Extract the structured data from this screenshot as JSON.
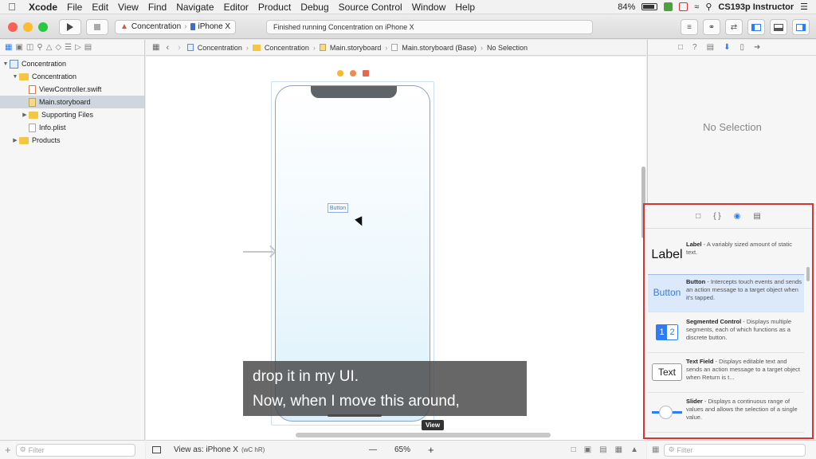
{
  "menubar": {
    "apple": "",
    "app": "Xcode",
    "items": [
      "File",
      "Edit",
      "View",
      "Find",
      "Navigate",
      "Editor",
      "Product",
      "Debug",
      "Source Control",
      "Window",
      "Help"
    ],
    "battery": "84%",
    "user": "CS193p Instructor"
  },
  "toolbar": {
    "scheme": "Concentration",
    "device": "iPhone X",
    "activity": "Finished running Concentration on iPhone X"
  },
  "navigator": {
    "tree": [
      {
        "label": "Concentration",
        "kind": "project",
        "disclosure": "▼",
        "indent": 0
      },
      {
        "label": "Concentration",
        "kind": "folder",
        "disclosure": "▼",
        "indent": 1
      },
      {
        "label": "ViewController.swift",
        "kind": "swift",
        "disclosure": "",
        "indent": 2
      },
      {
        "label": "Main.storyboard",
        "kind": "storyboard",
        "disclosure": "",
        "indent": 2,
        "selected": true
      },
      {
        "label": "Supporting Files",
        "kind": "folder",
        "disclosure": "▶",
        "indent": 2
      },
      {
        "label": "Info.plist",
        "kind": "plist",
        "disclosure": "",
        "indent": 2
      },
      {
        "label": "Products",
        "kind": "folder",
        "disclosure": "▶",
        "indent": 1
      }
    ],
    "filter_placeholder": "Filter"
  },
  "jumpbar": {
    "crumbs": [
      "Concentration",
      "Concentration",
      "Main.storyboard",
      "Main.storyboard (Base)",
      "No Selection"
    ]
  },
  "canvas": {
    "button_label": "Button",
    "view_tag": "View"
  },
  "caption": {
    "line1": "drop it in my UI.",
    "line2": "Now, when I move this around,"
  },
  "editor_bar": {
    "view_as": "View as: iPhone X",
    "view_as_suffix": "(wC hR)",
    "zoom_out": "—",
    "zoom": "65%",
    "zoom_in": "+"
  },
  "inspector": {
    "no_selection": "No Selection"
  },
  "library": {
    "items": [
      {
        "thumb": "Label",
        "title": "Label",
        "desc": " - A variably sized amount of static text."
      },
      {
        "thumb": "Button",
        "title": "Button",
        "desc": " - Intercepts touch events and sends an action message to a target object when it's tapped."
      },
      {
        "thumb": "1|2",
        "title": "Segmented Control",
        "desc": " - Displays multiple segments, each of which functions as a discrete button."
      },
      {
        "thumb": "Text",
        "title": "Text Field",
        "desc": " - Displays editable text and sends an action message to a target object when Return is t..."
      },
      {
        "thumb": "",
        "title": "Slider",
        "desc": " - Displays a continuous range of values and allows the selection of a single value."
      }
    ],
    "filter_placeholder": "Filter"
  },
  "colors": {
    "accent": "#2e7cf6",
    "highlight_border": "#d93434",
    "close": "#fc5f57",
    "minimize": "#fdbc2e",
    "zoom": "#28c840"
  }
}
